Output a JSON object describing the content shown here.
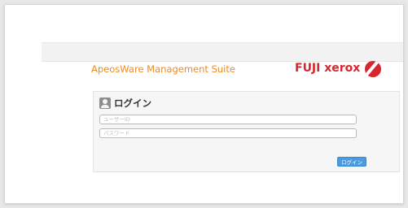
{
  "app": {
    "title": "ApeosWare Management Suite",
    "brand_name": "FUJI xerox",
    "brand_part1": "FUJI",
    "brand_part2": "xerox"
  },
  "login": {
    "heading": "ログイン",
    "user_id_placeholder": "ユーザーID",
    "password_placeholder": "パスワード",
    "button_label": "ログイン"
  },
  "colors": {
    "title_color": "#f08a1c",
    "brand_color": "#d7262d",
    "button_color": "#4a9be0"
  },
  "icons": {
    "login_heading_icon": "user-icon",
    "brand_logo": "fuji-xerox-logo-icon"
  }
}
